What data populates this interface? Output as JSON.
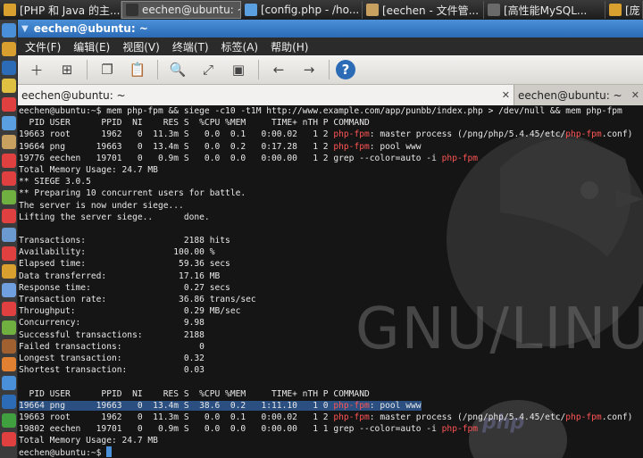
{
  "taskbar": {
    "tasks": [
      {
        "label": "[PHP 和 Java 的主...",
        "color": "#d9a030",
        "active": false
      },
      {
        "label": "eechen@ubuntu: ~",
        "color": "#333333",
        "active": true
      },
      {
        "label": "[config.php - /ho...",
        "color": "#5aa0e0",
        "active": false
      },
      {
        "label": "[eechen - 文件管...",
        "color": "#c8a060",
        "active": false
      },
      {
        "label": "[高性能MySQL...",
        "color": "#6a6a6a",
        "active": false
      },
      {
        "label": "[庞",
        "color": "#d9a030",
        "active": false
      }
    ]
  },
  "window": {
    "title": "eechen@ubuntu: ~",
    "menu": [
      "文件(F)",
      "编辑(E)",
      "视图(V)",
      "终端(T)",
      "标签(A)",
      "帮助(H)"
    ],
    "toolbar": [
      {
        "name": "new-tab-icon",
        "glyph": "＋"
      },
      {
        "name": "new-window-icon",
        "glyph": "⊞"
      },
      {
        "name": "copy-icon",
        "glyph": "❐"
      },
      {
        "name": "paste-icon",
        "glyph": "📋"
      },
      {
        "name": "search-icon",
        "glyph": "🔍"
      },
      {
        "name": "fullscreen-icon",
        "glyph": "⤢"
      },
      {
        "name": "preferences-icon",
        "glyph": "▣"
      },
      {
        "name": "back-icon",
        "glyph": "←"
      },
      {
        "name": "forward-icon",
        "glyph": "→"
      },
      {
        "name": "help-icon",
        "glyph": "?"
      }
    ],
    "tabs": [
      {
        "label": "eechen@ubuntu: ~",
        "close": "✕"
      },
      {
        "label": "eechen@ubuntu: ~",
        "close": "✕"
      }
    ]
  },
  "colors": {
    "highlight": "#ff5555",
    "selection": "#2a4f80",
    "title_blue": "#2c6bb5"
  },
  "terminal": {
    "background_logo_text": "GNU/LINUX",
    "lines": [
      [
        {
          "t": "eechen@ubuntu:~$ mem php-fpm && siege -c10 -t1M http://www.example.com/app/punbb/index.php > /dev/null && mem php-fpm"
        }
      ],
      [
        {
          "t": "  PID USER      PPID  NI    RES S  %CPU %MEM     TIME+ nTH P COMMAND"
        }
      ],
      [
        {
          "t": "19663 root      1962   0  11.3m S   0.0  0.1   0:00.02   1 2 "
        },
        {
          "t": "php-fpm",
          "hl": true
        },
        {
          "t": ": master process (/png/php/5.4.45/etc/"
        },
        {
          "t": "php-fpm",
          "hl": true
        },
        {
          "t": ".conf)"
        }
      ],
      [
        {
          "t": "19664 png      19663   0  13.4m S   0.0  0.2   0:17.28   1 2 "
        },
        {
          "t": "php-fpm",
          "hl": true
        },
        {
          "t": ": pool www"
        }
      ],
      [
        {
          "t": "19776 eechen   19701   0   0.9m S   0.0  0.0   0:00.00   1 2 grep --color=auto -i "
        },
        {
          "t": "php-fpm",
          "hl": true
        }
      ],
      [
        {
          "t": "Total Memory Usage: 24.7 MB"
        }
      ],
      [
        {
          "t": "** SIEGE 3.0.5"
        }
      ],
      [
        {
          "t": "** Preparing 10 concurrent users for battle."
        }
      ],
      [
        {
          "t": "The server is now under siege..."
        }
      ],
      [
        {
          "t": "Lifting the server siege..      done."
        }
      ],
      [
        {
          "t": ""
        }
      ],
      [
        {
          "t": "Transactions:                   2188 hits"
        }
      ],
      [
        {
          "t": "Availability:                 100.00 %"
        }
      ],
      [
        {
          "t": "Elapsed time:                  59.36 secs"
        }
      ],
      [
        {
          "t": "Data transferred:              17.16 MB"
        }
      ],
      [
        {
          "t": "Response time:                  0.27 secs"
        }
      ],
      [
        {
          "t": "Transaction rate:              36.86 trans/sec"
        }
      ],
      [
        {
          "t": "Throughput:                     0.29 MB/sec"
        }
      ],
      [
        {
          "t": "Concurrency:                    9.98"
        }
      ],
      [
        {
          "t": "Successful transactions:        2188"
        }
      ],
      [
        {
          "t": "Failed transactions:               0"
        }
      ],
      [
        {
          "t": "Longest transaction:            0.32"
        }
      ],
      [
        {
          "t": "Shortest transaction:           0.03"
        }
      ],
      [
        {
          "t": ""
        }
      ],
      [
        {
          "t": "  PID USER      PPID  NI    RES S  %CPU %MEM     TIME+ nTH P COMMAND"
        }
      ],
      [
        {
          "t": "19664 png      19663   0  13.4m S  38.6  0.2   1:11.10   1 0 ",
          "sel": true
        },
        {
          "t": "php-fpm",
          "hl": true,
          "sel": true
        },
        {
          "t": ": pool www",
          "sel": true
        }
      ],
      [
        {
          "t": "19663 root      1962   0  11.3m S   0.0  0.1   0:00.02   1 2 "
        },
        {
          "t": "php-fpm",
          "hl": true
        },
        {
          "t": ": master process (/png/php/5.4.45/etc/"
        },
        {
          "t": "php-fpm",
          "hl": true
        },
        {
          "t": ".conf)"
        }
      ],
      [
        {
          "t": "19802 eechen   19701   0   0.9m S   0.0  0.0   0:00.00   1 1 grep --color=auto -i "
        },
        {
          "t": "php-fpm",
          "hl": true
        }
      ],
      [
        {
          "t": "Total Memory Usage: 24.7 MB"
        }
      ],
      [
        {
          "t": "eechen@ubuntu:~$ "
        },
        {
          "t": "",
          "cursor": true
        }
      ]
    ]
  }
}
